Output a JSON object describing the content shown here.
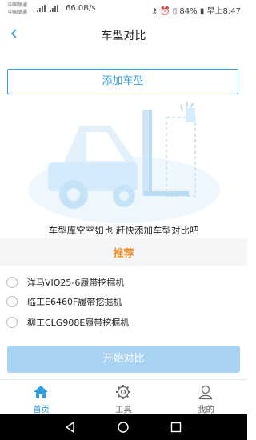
{
  "status_bar": {
    "carrier_top": "中国联通",
    "carrier_bottom": "中国联通",
    "speed": "66.0B/s",
    "battery": "84%",
    "time": "早上8:47"
  },
  "header": {
    "back_icon": "chevron-left-icon",
    "title": "车型对比"
  },
  "add_button_label": "添加车型",
  "empty_message": "车型库空空如也 赶快添加车型对比吧",
  "recommend": {
    "title": "推荐",
    "items": [
      {
        "name": "洋马VIO25-6履带挖掘机"
      },
      {
        "name": "临工E6460F履带挖掘机"
      },
      {
        "name": "柳工CLG908E履带挖掘机"
      }
    ]
  },
  "start_button_label": "开始对比",
  "tabs": [
    {
      "label": "首页",
      "icon": "home-icon",
      "active": true
    },
    {
      "label": "工具",
      "icon": "gear-icon",
      "active": false
    },
    {
      "label": "我的",
      "icon": "user-icon",
      "active": false
    }
  ],
  "colors": {
    "accent": "#2f9be0",
    "recommend": "#f08a24",
    "start_button": "#a9d3f3",
    "inactive_tab": "#666666"
  }
}
